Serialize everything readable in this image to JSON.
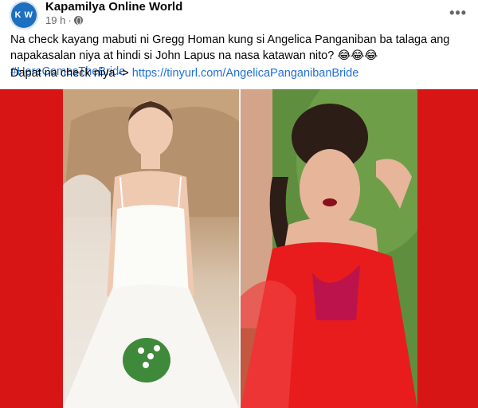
{
  "post": {
    "page_name": "Kapamilya Online World",
    "avatar_text": "K W",
    "time": "19 h",
    "separator": "·",
    "privacy_icon": "globe-icon",
    "more_icon": "more-options-icon",
    "more_label": "•••",
    "text_line1_part1": "Na check kayang mabuti ni Gregg Homan kung si Angelica Panganiban ba talaga ang napakasalan niya at hindi si John Lapus na nasa katawan nito? ",
    "emoji": "😂😂😂",
    "hashtag": "#HereComesTheBride",
    "text_line2_prefix": "Dapat na check niya -> ",
    "link": "https://tinyurl.com/AngelicaPanganibanBride"
  },
  "colors": {
    "link": "#216fdb",
    "image_background": "#d81515",
    "avatar": "#1d6fbf"
  }
}
